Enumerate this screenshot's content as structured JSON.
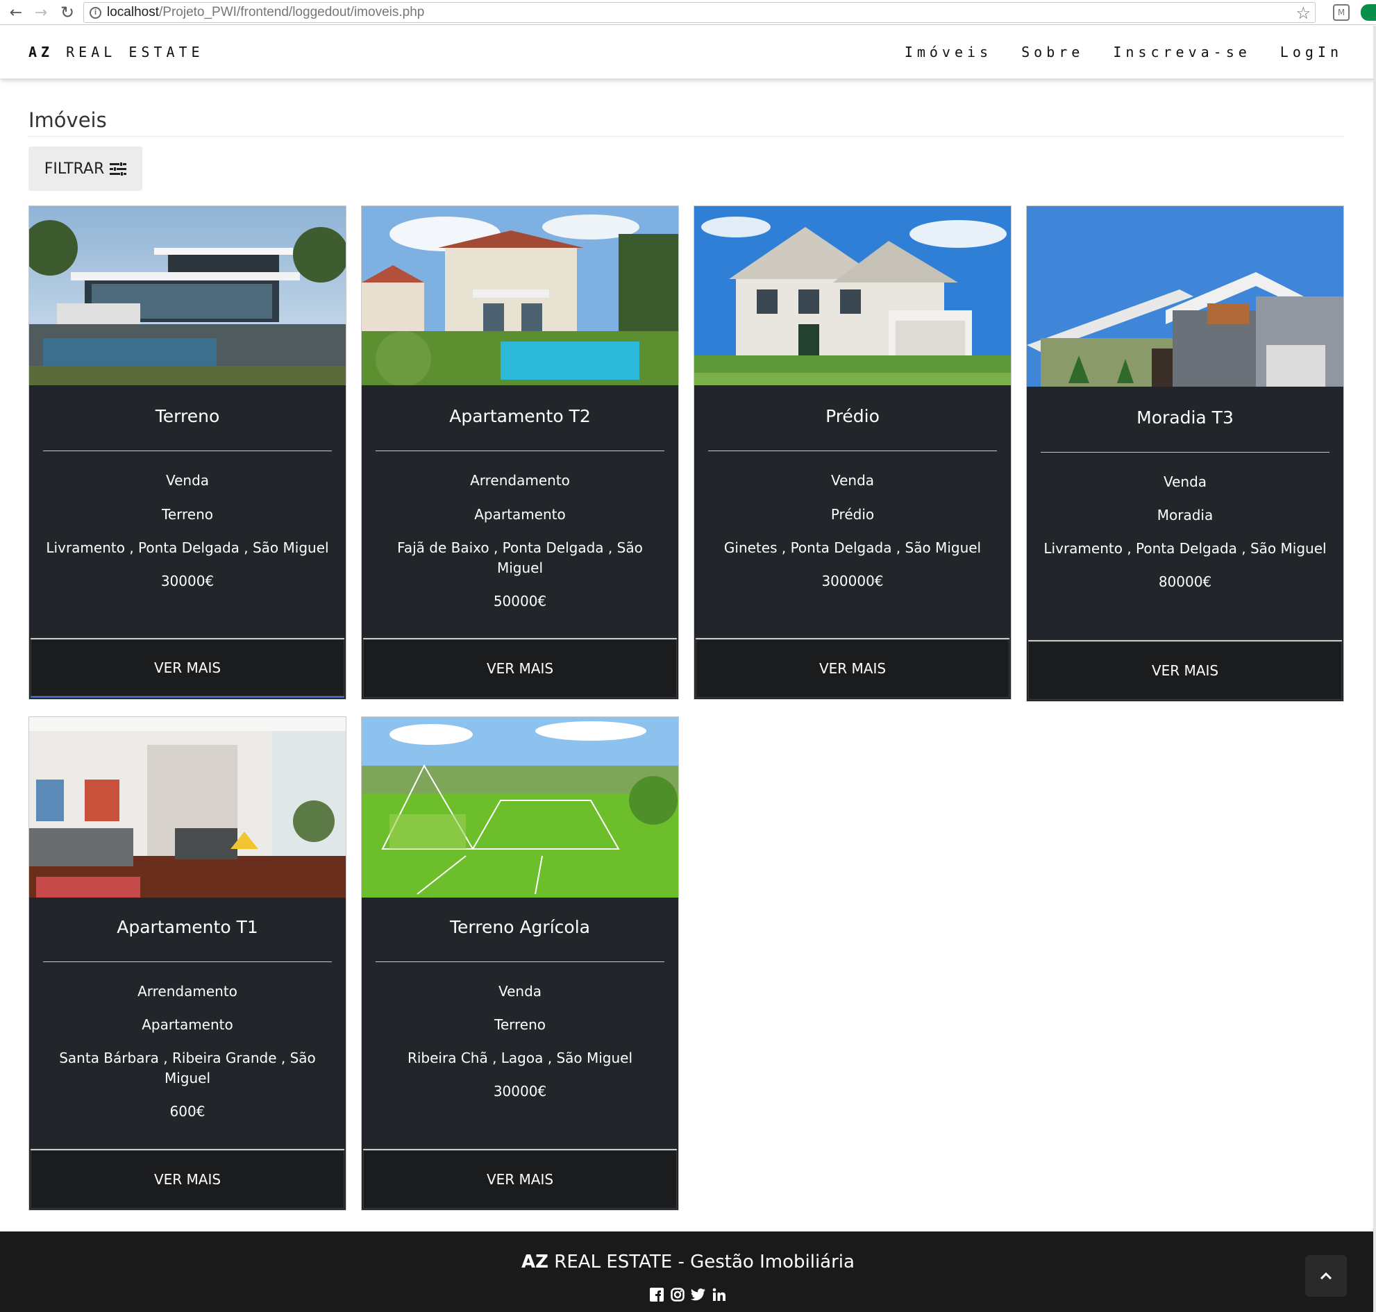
{
  "browser": {
    "url_host": "localhost",
    "url_path": "/Projeto_PWI/frontend/loggedout/imoveis.php"
  },
  "brand": {
    "bold": "AZ",
    "rest": "REAL ESTATE"
  },
  "nav": [
    "Imóveis",
    "Sobre",
    "Inscreva-se",
    "LogIn"
  ],
  "page": {
    "title": "Imóveis",
    "filter_label": "FILTRAR"
  },
  "cards": [
    {
      "title": "Terreno",
      "deal": "Venda",
      "type": "Terreno",
      "location": "Livramento , Ponta Delgada , São Miguel",
      "price": "30000€",
      "button": "VER MAIS",
      "image": "modern-villa-pool"
    },
    {
      "title": "Apartamento T2",
      "deal": "Arrendamento",
      "type": "Apartamento",
      "location": "Fajã de Baixo , Ponta Delgada , São Miguel",
      "price": "50000€",
      "button": "VER MAIS",
      "image": "house-with-pool"
    },
    {
      "title": "Prédio",
      "deal": "Venda",
      "type": "Prédio",
      "location": "Ginetes , Ponta Delgada , São Miguel",
      "price": "300000€",
      "button": "VER MAIS",
      "image": "white-suburban-house"
    },
    {
      "title": "Moradia T3",
      "deal": "Venda",
      "type": "Moradia",
      "location": "Livramento , Ponta Delgada , São Miguel",
      "price": "80000€",
      "button": "VER MAIS",
      "image": "modern-grey-house"
    },
    {
      "title": "Apartamento T1",
      "deal": "Arrendamento",
      "type": "Apartamento",
      "location": "Santa Bárbara , Ribeira Grande , São Miguel",
      "price": "600€",
      "button": "VER MAIS",
      "image": "living-room-interior"
    },
    {
      "title": "Terreno Agrícola",
      "deal": "Venda",
      "type": "Terreno",
      "location": "Ribeira Chã , Lagoa , São Miguel",
      "price": "30000€",
      "button": "VER MAIS",
      "image": "green-field-house-sketch"
    }
  ],
  "footer": {
    "bold": "AZ",
    "rest": "REAL ESTATE - Gestão Imobiliária"
  },
  "social": [
    "facebook-icon",
    "instagram-icon",
    "twitter-icon",
    "linkedin-icon"
  ]
}
